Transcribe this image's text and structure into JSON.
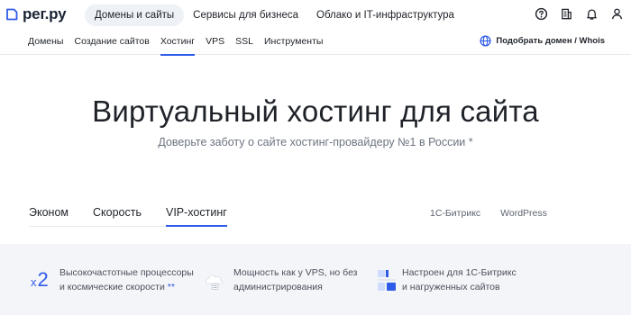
{
  "logo": {
    "text": "рег.ру"
  },
  "top_nav": {
    "items": [
      {
        "label": "Домены и сайты",
        "active": true
      },
      {
        "label": "Сервисы для бизнеса",
        "active": false
      },
      {
        "label": "Облако и IT-инфраструктура",
        "active": false
      }
    ]
  },
  "top_icons": [
    "help-icon",
    "cart-list-icon",
    "bell-icon",
    "user-icon"
  ],
  "sub_nav": {
    "items": [
      {
        "label": "Домены",
        "active": false
      },
      {
        "label": "Создание сайтов",
        "active": false
      },
      {
        "label": "Хостинг",
        "active": true
      },
      {
        "label": "VPS",
        "active": false
      },
      {
        "label": "SSL",
        "active": false
      },
      {
        "label": "Инструменты",
        "active": false
      }
    ],
    "domain_search_label": "Подобрать домен / Whois"
  },
  "hero": {
    "title": "Виртуальный хостинг для сайта",
    "subtitle": "Доверьте заботу о сайте хостинг-провайдеру №1 в России *"
  },
  "tabs": {
    "items": [
      {
        "label": "Эконом",
        "active": false
      },
      {
        "label": "Скорость",
        "active": false
      },
      {
        "label": "VIP-хостинг",
        "active": true
      }
    ],
    "cms": [
      "1С-Битрикс",
      "WordPress"
    ]
  },
  "features": {
    "speed_multiplier": {
      "prefix": "x",
      "value": "2"
    },
    "items": [
      {
        "line1": "Высокочастотные процессоры",
        "line2": "и космические скорости",
        "note": "**"
      },
      {
        "line1": "Мощность как у VPS, но без",
        "line2": "администрирования"
      },
      {
        "line1": "Настроен для 1С-Битрикс",
        "line2": "и нагруженных сайтов"
      }
    ]
  },
  "colors": {
    "accent": "#2f5bea",
    "pill_bg": "#eef1f6",
    "band_bg": "#f4f5f8"
  }
}
